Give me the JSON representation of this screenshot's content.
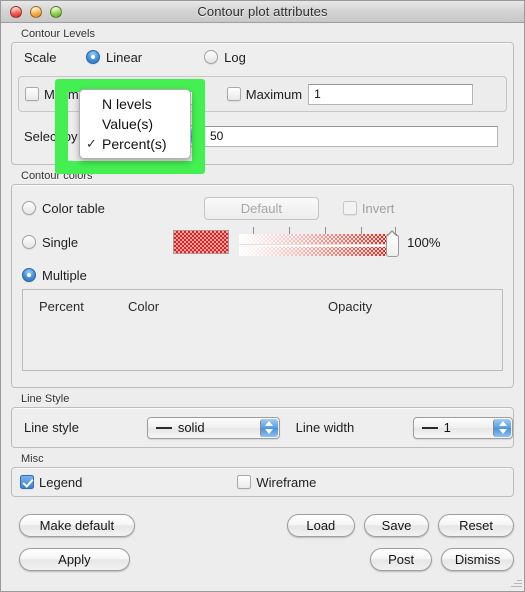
{
  "window": {
    "title": "Contour plot attributes",
    "traffic_lights": [
      "close-button",
      "minimize-button",
      "zoom-button"
    ]
  },
  "contour_levels": {
    "group_label": "Contour Levels",
    "scale_label": "Scale",
    "scale_options": [
      {
        "label": "Linear",
        "selected": true
      },
      {
        "label": "Log",
        "selected": false
      }
    ],
    "minimum": {
      "label": "Minimum",
      "checked": false,
      "value": ""
    },
    "maximum": {
      "label": "Maximum",
      "checked": false,
      "value": "1"
    },
    "select_by": {
      "label": "Select by",
      "value": "Percent(s)"
    },
    "n_value": "50"
  },
  "dropdown": {
    "open": true,
    "items": [
      {
        "label": "N levels",
        "checked": false
      },
      {
        "label": "Value(s)",
        "checked": false
      },
      {
        "label": "Percent(s)",
        "checked": true
      }
    ],
    "check_glyph": "✓",
    "highlight_color": "#44ef51"
  },
  "contour_colors": {
    "group_label": "Contour colors",
    "options": [
      {
        "label": "Color table",
        "selected": false
      },
      {
        "label": "Single",
        "selected": false
      },
      {
        "label": "Multiple",
        "selected": true
      }
    ],
    "default_button": "Default",
    "invert_checkbox": {
      "label": "Invert",
      "checked": false,
      "disabled": true
    },
    "swatch_color": "#ee1c19",
    "opacity_value": "100%",
    "opacity_percent": 100,
    "table": {
      "headers": [
        "Percent",
        "Color",
        "Opacity"
      ],
      "rows": []
    }
  },
  "line_style": {
    "group_label": "Line Style",
    "style_label": "Line style",
    "style_value": "solid",
    "width_label": "Line width",
    "width_value": "1"
  },
  "misc": {
    "group_label": "Misc",
    "legend": {
      "label": "Legend",
      "checked": true
    },
    "wireframe": {
      "label": "Wireframe",
      "checked": false
    }
  },
  "buttons": {
    "make_default": "Make default",
    "apply": "Apply",
    "load": "Load",
    "save": "Save",
    "reset": "Reset",
    "post": "Post",
    "dismiss": "Dismiss"
  }
}
